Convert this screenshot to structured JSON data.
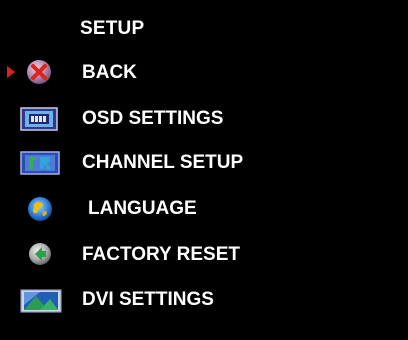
{
  "menu": {
    "title": "SETUP",
    "selected_index": 0,
    "items": [
      {
        "label": "BACK",
        "icon": "back-x-icon"
      },
      {
        "label": "OSD SETTINGS",
        "icon": "osd-settings-icon"
      },
      {
        "label": "CHANNEL SETUP",
        "icon": "channel-setup-icon"
      },
      {
        "label": "LANGUAGE",
        "icon": "globe-icon"
      },
      {
        "label": "FACTORY RESET",
        "icon": "reset-icon"
      },
      {
        "label": "DVI SETTINGS",
        "icon": "dvi-settings-icon"
      }
    ]
  },
  "colors": {
    "background": "#000000",
    "text": "#ffffff",
    "pointer": "#e0211c"
  }
}
